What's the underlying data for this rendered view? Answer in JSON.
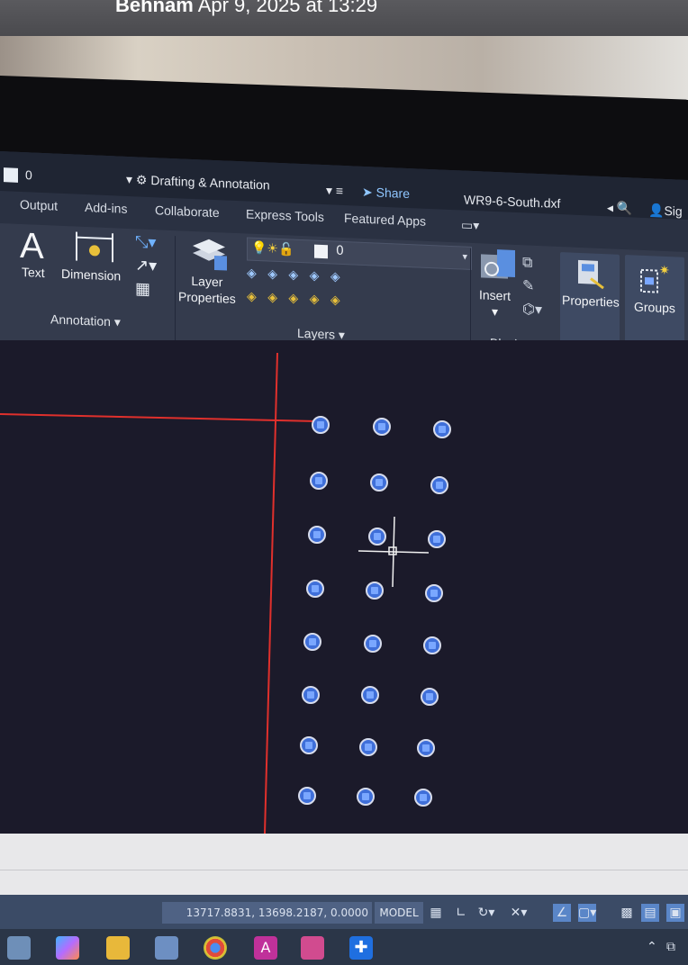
{
  "message": {
    "sender": "Behnam",
    "timestamp": "Apr 9, 2025 at 13:29"
  },
  "titlebar": {
    "layer_value": "0",
    "workspace": "Drafting & Annotation",
    "share": "Share",
    "filename": "WR9-6-South.dxf",
    "sign_in": "Sig"
  },
  "tabs": [
    "Output",
    "Add-ins",
    "Collaborate",
    "Express Tools",
    "Featured Apps"
  ],
  "ribbon": {
    "annotation": {
      "text_label": "Text",
      "dimension_label": "Dimension",
      "panel_label": "Annotation"
    },
    "layers": {
      "layer_properties_label": "Layer\nProperties",
      "current_layer": "0",
      "panel_label": "Layers"
    },
    "block": {
      "insert_label": "Insert",
      "panel_label": "Block"
    },
    "properties_label": "Properties",
    "groups_label": "Groups"
  },
  "status": {
    "coordinates": "13717.8831, 13698.2187, 0.0000",
    "space": "MODEL"
  },
  "colors": {
    "ribbon_bg": "#343b4d",
    "canvas_bg": "#1b1a2a",
    "node_fill": "#3f6fd9",
    "red_line": "#e0302c",
    "status_bg": "#3b4b66"
  }
}
